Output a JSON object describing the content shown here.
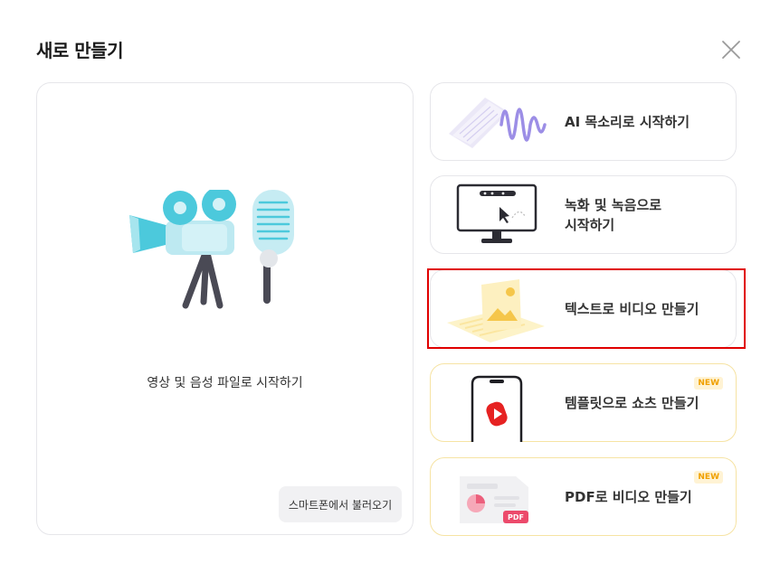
{
  "dialog": {
    "title": "새로 만들기"
  },
  "left_card": {
    "label": "영상 및 음성 파일로 시작하기",
    "phone_button": "스마트폰에서 불러오기"
  },
  "options": [
    {
      "label": "AI 목소리로 시작하기",
      "badge": ""
    },
    {
      "label": "녹화 및 녹음으로\n시작하기",
      "badge": ""
    },
    {
      "label": "텍스트로 비디오 만들기",
      "badge": ""
    },
    {
      "label": "템플릿으로 쇼츠 만들기",
      "badge": "NEW"
    },
    {
      "label": "PDF로 비디오 만들기",
      "badge": "NEW"
    }
  ],
  "pdf_tag": "PDF",
  "colors": {
    "highlight": "#e00000",
    "new_badge": "#f0a000",
    "accent_cyan": "#4cc9dc"
  }
}
